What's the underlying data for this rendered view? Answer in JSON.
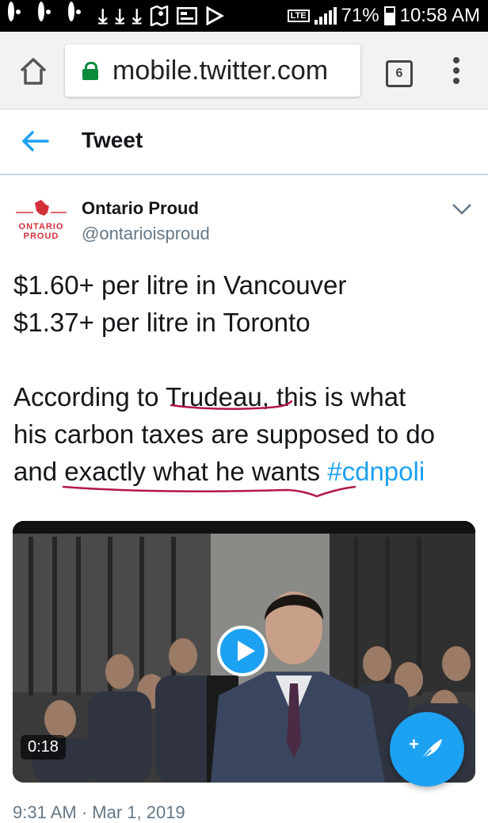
{
  "status_bar": {
    "battery": "71%",
    "time": "10:58 AM",
    "network": "LTE",
    "icons": [
      "sync-icon",
      "sync-icon",
      "sync-icon",
      "download-icon",
      "download-icon",
      "download-icon",
      "maps-icon",
      "news-icon",
      "play-store-icon"
    ]
  },
  "browser": {
    "url": "mobile.twitter.com",
    "tab_count": "6"
  },
  "header": {
    "title": "Tweet"
  },
  "tweet": {
    "author_name": "Ontario Proud",
    "author_handle": "@ontarioisproud",
    "avatar_logo_line1": "ONTARIO",
    "avatar_logo_line2": "PROUD",
    "line1": "$1.60+ per litre in Vancouver",
    "line2": "$1.37+ per litre in Toronto",
    "line3_pre": "According to Trudeau, this is what",
    "line4": "his carbon taxes are supposed to do",
    "line5_text": "and exactly what he wants ",
    "hashtag": "#cdnpoli",
    "timestamp_partial": "9:31 AM · Mar 1, 2019"
  },
  "video": {
    "duration": "0:18"
  },
  "colors": {
    "accent": "#1da1f2",
    "annotation": "#b3174a",
    "secure": "#0a8a3a"
  }
}
